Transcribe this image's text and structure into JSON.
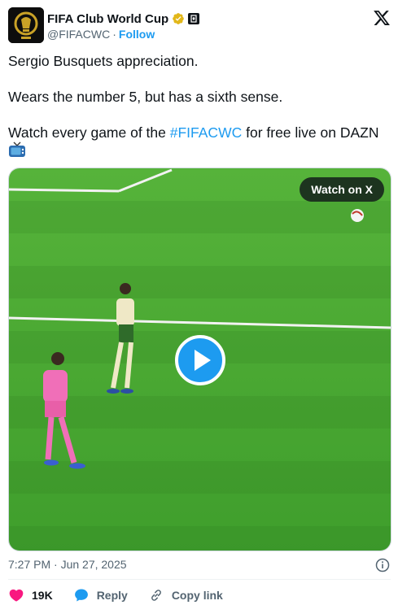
{
  "account": {
    "name": "FIFA Club World Cup",
    "handle": "@FIFACWC",
    "separator": "·",
    "follow_label": "Follow",
    "avatar_icon": "club-world-cup-trophy-logo",
    "verified_color": "#e2b719"
  },
  "tweet": {
    "line1": "Sergio Busquets appreciation.",
    "line2": "Wears the number 5, but has a sixth sense.",
    "line3_prefix": "Watch every game of the ",
    "hashtag": "#FIFACWC",
    "line3_suffix": " for free live on DAZN",
    "emoji_icon": "television-icon"
  },
  "media": {
    "watch_label": "Watch on X",
    "play_icon": "play-icon"
  },
  "meta": {
    "timestamp": "7:27 PM · Jun 27, 2025"
  },
  "actions": {
    "likes_count": "19K",
    "reply_label": "Reply",
    "copy_label": "Copy link"
  },
  "colors": {
    "accent": "#1d9bf0",
    "like": "#f91880",
    "pitch": "#4caf32"
  }
}
